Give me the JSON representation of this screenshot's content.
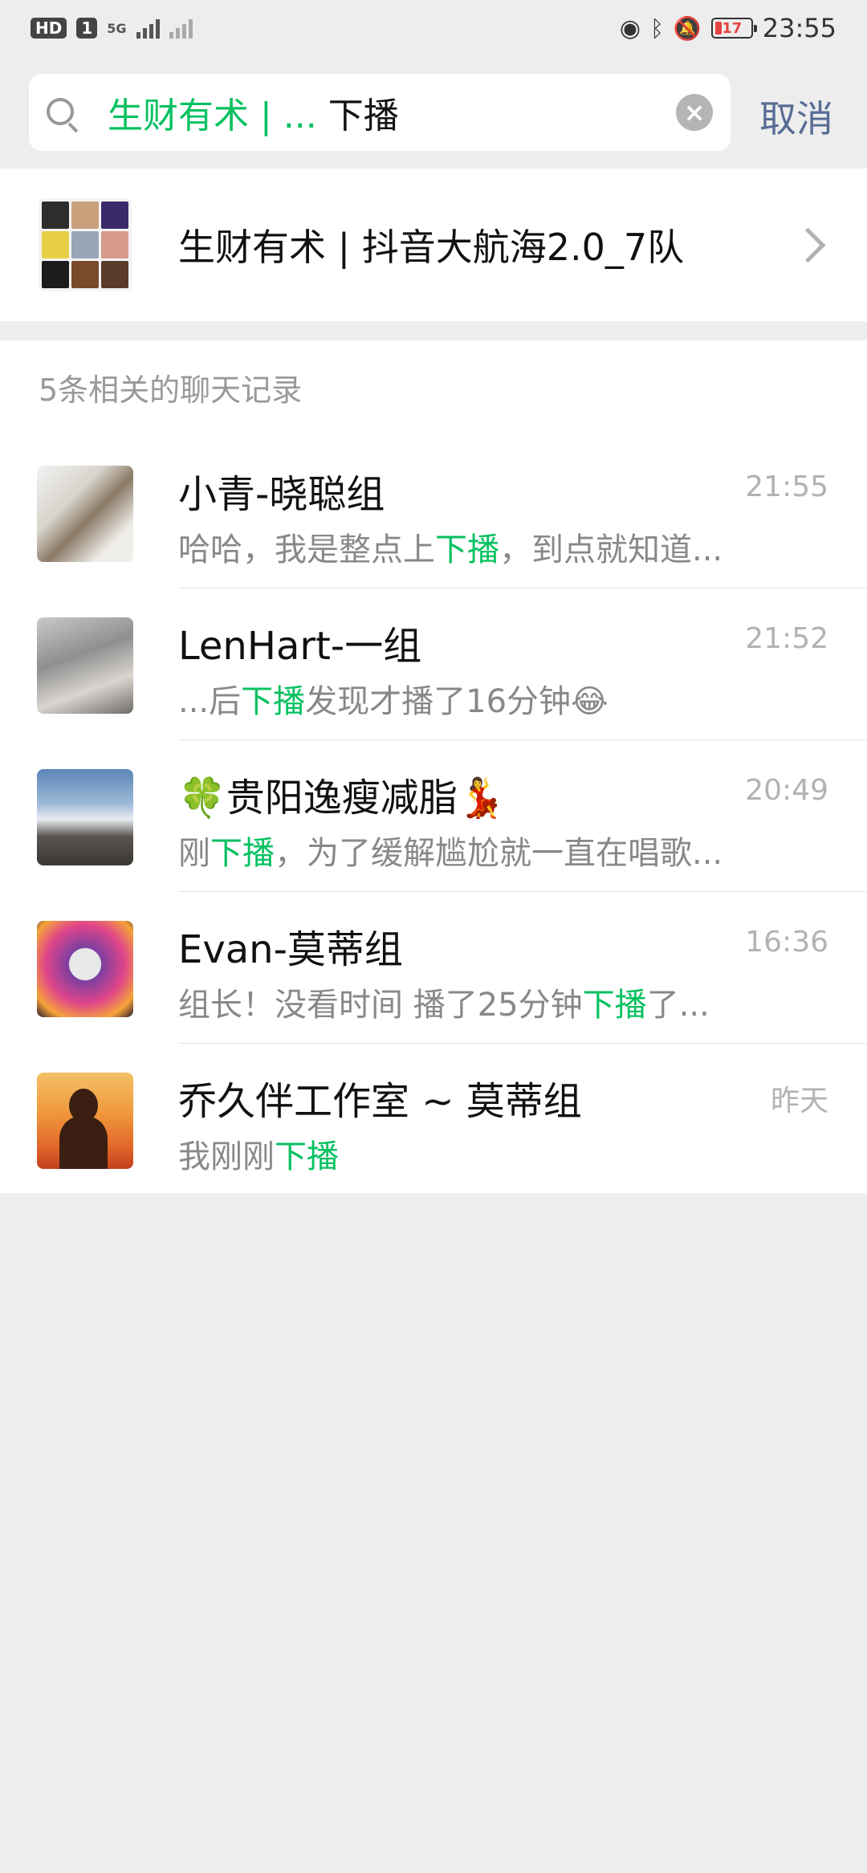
{
  "status_bar": {
    "hd_label": "HD",
    "sim_label": "1",
    "network_label": "5G",
    "battery_level": "17",
    "time": "23:55",
    "icons": [
      "eye-icon",
      "bluetooth-icon",
      "mute-icon"
    ]
  },
  "search": {
    "query_prefix": "生财有术 | ...",
    "query_suffix": " 下播",
    "cancel_label": "取消"
  },
  "group": {
    "name": "生财有术 | 抖音大航海2.0_7队",
    "avatar_colors": [
      "#2d2d2d",
      "#c8a07c",
      "#3b2a6a",
      "#e8d046",
      "#9aa5b5",
      "#d79a8a",
      "#1c1c1c",
      "#7a4a2a",
      "#5a3a2a"
    ]
  },
  "results": {
    "header": "5条相关的聊天记录",
    "chats": [
      {
        "name": "小青-晓聪组",
        "time": "21:55",
        "msg_before": "哈哈，我是整点上",
        "msg_highlight": "下播",
        "msg_after": "，到点就知道..."
      },
      {
        "name": "LenHart-一组",
        "time": "21:52",
        "msg_before": "...后",
        "msg_highlight": "下播",
        "msg_after": "发现才播了16分钟😂"
      },
      {
        "name": "🍀贵阳逸瘦减脂💃",
        "time": "20:49",
        "msg_before": "刚",
        "msg_highlight": "下播",
        "msg_after": "，为了缓解尴尬就一直在唱歌..."
      },
      {
        "name": "Evan-莫蒂组",
        "time": "16:36",
        "msg_before": "组长！没看时间 播了25分钟",
        "msg_highlight": "下播",
        "msg_after": "了..."
      },
      {
        "name": "乔久伴工作室 ~ 莫蒂组",
        "time": "昨天",
        "msg_before": "我刚刚",
        "msg_highlight": "下播",
        "msg_after": ""
      }
    ]
  },
  "colors": {
    "highlight": "#07c160",
    "link": "#576b95",
    "background": "#ededed"
  }
}
